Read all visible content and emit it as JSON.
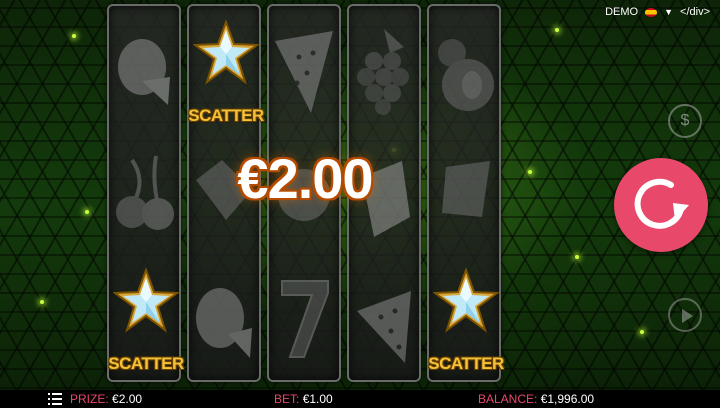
{
  "header": {
    "mode": "DEMO",
    "language_icon": "spain-flag-icon",
    "tag_text": "</div>"
  },
  "win": {
    "amount": "€2.00"
  },
  "reels": [
    [
      "melon-slice",
      "cherry",
      "scatter"
    ],
    [
      "scatter",
      "plum",
      "melon-slice"
    ],
    [
      "watermelon",
      "melon",
      "seven"
    ],
    [
      "grapes",
      "lemon",
      "watermelon"
    ],
    [
      "plum",
      "grapes",
      "scatter"
    ]
  ],
  "symbols": {
    "scatter_label": "SCATTER"
  },
  "colors": {
    "accent": "#e8496b",
    "scatter_gold": "#f6c23a",
    "win_outline": "#b04a00"
  },
  "controls": {
    "spin_icon": "spin-arrow-icon",
    "coin_icon": "coin-dollar-icon",
    "coin_symbol": "$",
    "autoplay_icon": "play-icon"
  },
  "footer": {
    "menu_icon": "menu-list-icon",
    "prize_label": "PRIZE:",
    "prize_value": "€2.00",
    "bet_label": "BET:",
    "bet_value": "€1.00",
    "balance_label": "BALANCE:",
    "balance_value": "€1,996.00"
  }
}
